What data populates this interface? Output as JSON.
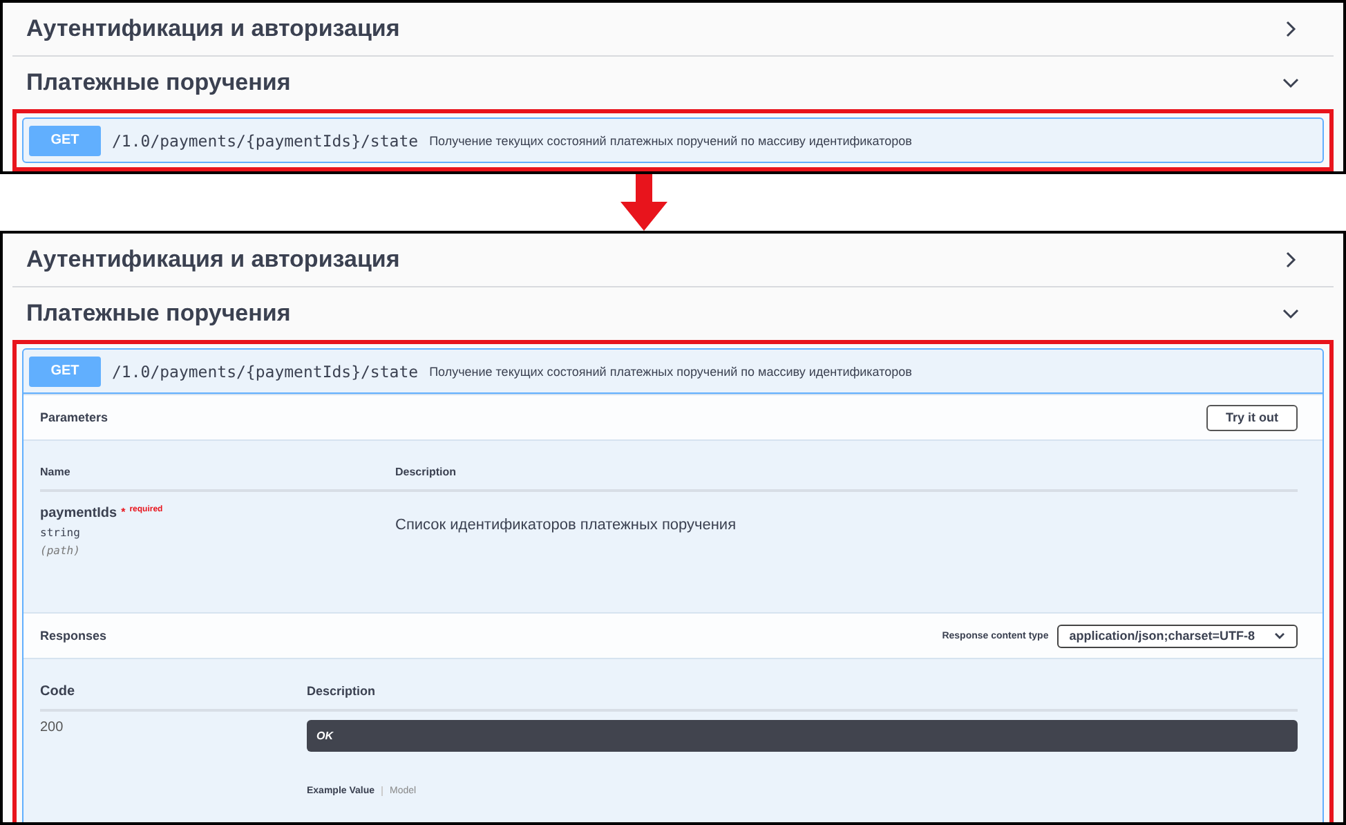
{
  "panels": [
    {
      "sections": [
        {
          "title": "Аутентификация и авторизация",
          "expanded": false
        },
        {
          "title": "Платежные поручения",
          "expanded": true
        }
      ],
      "endpoint": {
        "method": "GET",
        "path": "/1.0/payments/{paymentIds}/state",
        "summary": "Получение текущих состояний платежных поручений по массиву идентификаторов",
        "expanded": false
      }
    },
    {
      "sections": [
        {
          "title": "Аутентификация и авторизация",
          "expanded": false
        },
        {
          "title": "Платежные поручения",
          "expanded": true
        }
      ],
      "endpoint": {
        "method": "GET",
        "path": "/1.0/payments/{paymentIds}/state",
        "summary": "Получение текущих состояний платежных поручений по массиву идентификаторов",
        "expanded": true,
        "parameters": {
          "title": "Parameters",
          "try_button": "Try it out",
          "columns": [
            "Name",
            "Description"
          ],
          "rows": [
            {
              "name": "paymentIds",
              "required_mark": "*",
              "required": "required",
              "type": "string",
              "location": "(path)",
              "description": "Список идентификаторов платежных поручения"
            }
          ]
        },
        "responses": {
          "title": "Responses",
          "content_type_label": "Response content type",
          "content_type": "application/json;charset=UTF-8",
          "columns": [
            "Code",
            "Description"
          ],
          "rows": [
            {
              "code": "200",
              "description": "OK",
              "tabs": [
                {
                  "label": "Example Value",
                  "selected": true
                },
                {
                  "label": "Model",
                  "selected": false
                }
              ]
            }
          ]
        }
      }
    }
  ]
}
